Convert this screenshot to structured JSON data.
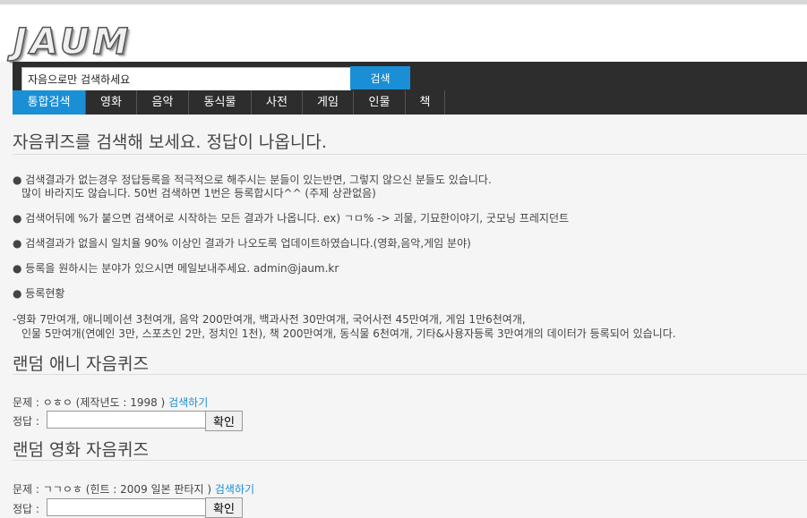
{
  "logo": {
    "text": "JAUM"
  },
  "search": {
    "value": "자음으로만 검색하세요",
    "button_label": "검색"
  },
  "nav": {
    "tabs": [
      {
        "label": "통합검색",
        "active": true
      },
      {
        "label": "영화"
      },
      {
        "label": "음악"
      },
      {
        "label": "동식물"
      },
      {
        "label": "사전"
      },
      {
        "label": "게임"
      },
      {
        "label": "인물"
      },
      {
        "label": "책"
      }
    ]
  },
  "intro": {
    "title": "자음퀴즈를 검색해 보세요. 정답이 나옵니다.",
    "bullets": [
      "● 검색결과가 없는경우 정답등록을 적극적으로 해주시는 분들이 있는반면, 그렇지 않으신 분들도 있습니다.",
      "많이 바라지도 않습니다. 50번 검색하면 1번은 등록합시다^^ (주제 상관없음)",
      "● 검색어뒤에 %가 붙으면 검색어로 시작하는 모든 결과가 나옵니다. ex) ㄱㅁ% -> 괴물, 기묘한이야기, 굿모닝 프레지던트",
      "● 검색결과가 없을시 일치율 90% 이상인 결과가 나오도록 업데이트하였습니다.(영화,음악,게임 분야)",
      "● 등록을 원하시는 분야가 있으시면 메일보내주세요. admin@jaum.kr",
      "● 등록현황"
    ],
    "stats": [
      "-영화 7만여개, 애니메이션 3천여개, 음악 200만여개, 백과사전 30만여개, 국어사전 45만여개, 게임 1만6천여개,",
      "인물 5만여개(연예인 3만, 스포츠인 2만, 정치인 1천), 책 200만여개, 동식물 6천여개, 기타&사용자등록 3만여개의 데이터가 등록되어 있습니다."
    ]
  },
  "quiz_anime": {
    "title": "랜덤 애니 자음퀴즈",
    "question": "문제 : ㅇㅎㅇ (제작년도 : 1998 )",
    "search_link": "검색하기",
    "answer_label": "정답 :",
    "answer_value": "",
    "confirm_label": "확인"
  },
  "quiz_movie": {
    "title": "랜덤 영화 자음퀴즈",
    "question": "문제 : ㄱㄱㅇㅎ (힌트 : 2009 일본 판타지 )",
    "search_link": "검색하기",
    "answer_label": "정답 :",
    "answer_value": "",
    "confirm_label": "확인"
  },
  "colors": {
    "accent": "#1a8fd6",
    "nav_bg": "#2d2d2d",
    "page_bg": "#f5f5f5"
  }
}
